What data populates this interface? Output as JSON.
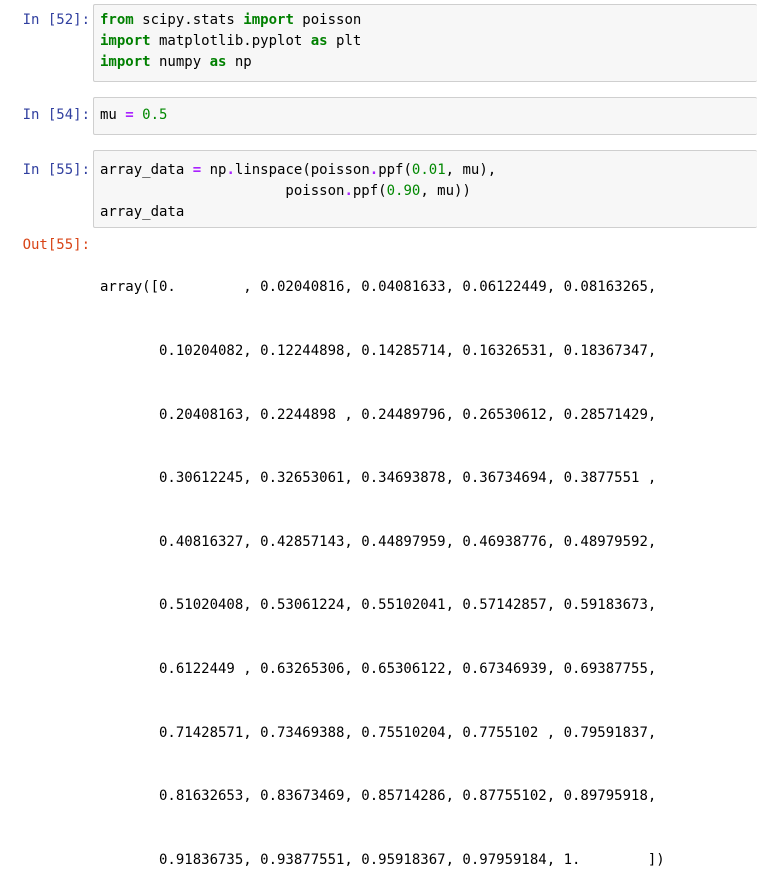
{
  "cells": [
    {
      "prompt": "In [52]:",
      "lines": [
        [
          {
            "t": "from",
            "k": "kw"
          },
          {
            "t": " scipy.stats "
          },
          {
            "t": "import",
            "k": "kw"
          },
          {
            "t": " poisson"
          }
        ],
        [
          {
            "t": "import",
            "k": "kw"
          },
          {
            "t": " matplotlib.pyplot "
          },
          {
            "t": "as",
            "k": "kw"
          },
          {
            "t": " plt"
          }
        ],
        [
          {
            "t": "import",
            "k": "kw"
          },
          {
            "t": " numpy "
          },
          {
            "t": "as",
            "k": "kw"
          },
          {
            "t": " np"
          }
        ]
      ]
    },
    {
      "prompt": "In [54]:",
      "lines": [
        [
          {
            "t": "mu "
          },
          {
            "t": "=",
            "k": "op"
          },
          {
            "t": " "
          },
          {
            "t": "0.5",
            "k": "num"
          }
        ]
      ]
    },
    {
      "prompt": "In [55]:",
      "lines": [
        [
          {
            "t": "array_data "
          },
          {
            "t": "=",
            "k": "op"
          },
          {
            "t": " np"
          },
          {
            "t": ".",
            "k": "op"
          },
          {
            "t": "linspace(poisson"
          },
          {
            "t": ".",
            "k": "op"
          },
          {
            "t": "ppf("
          },
          {
            "t": "0.01",
            "k": "num"
          },
          {
            "t": ", mu),"
          }
        ],
        [
          {
            "t": "                      poisson"
          },
          {
            "t": ".",
            "k": "op"
          },
          {
            "t": "ppf("
          },
          {
            "t": "0.90",
            "k": "num"
          },
          {
            "t": ", mu))"
          }
        ],
        [
          {
            "t": "array_data"
          }
        ]
      ]
    }
  ],
  "output": {
    "prompt": "Out[55]:",
    "lines": [
      "array([0.        , 0.02040816, 0.04081633, 0.06122449, 0.08163265,",
      "       0.10204082, 0.12244898, 0.14285714, 0.16326531, 0.18367347,",
      "       0.20408163, 0.2244898 , 0.24489796, 0.26530612, 0.28571429,",
      "       0.30612245, 0.32653061, 0.34693878, 0.36734694, 0.3877551 ,",
      "       0.40816327, 0.42857143, 0.44897959, 0.46938776, 0.48979592,",
      "       0.51020408, 0.53061224, 0.55102041, 0.57142857, 0.59183673,",
      "       0.6122449 , 0.63265306, 0.65306122, 0.67346939, 0.69387755,",
      "       0.71428571, 0.73469388, 0.75510204, 0.7755102 , 0.79591837,",
      "       0.81632653, 0.83673469, 0.85714286, 0.87755102, 0.89795918,",
      "       0.91836735, 0.93877551, 0.95918367, 0.97959184, 1.        ])"
    ]
  }
}
